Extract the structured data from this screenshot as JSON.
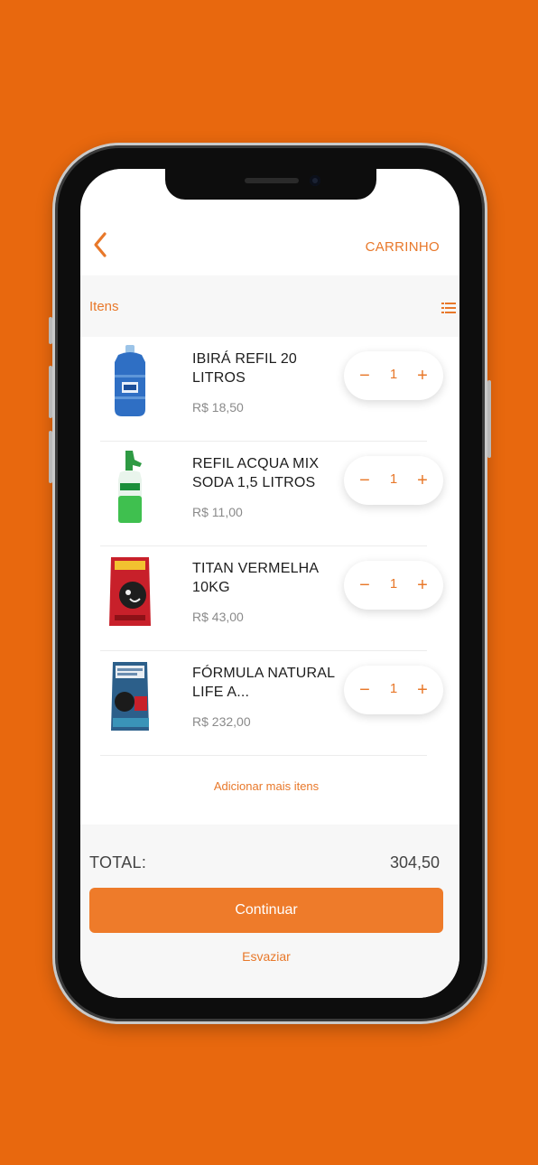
{
  "header": {
    "title": "CARRINHO"
  },
  "section": {
    "label": "Itens"
  },
  "items": [
    {
      "name": "IBIRÁ REFIL 20 LITROS",
      "price": "R$ 18,50",
      "qty": "1",
      "minus": "−",
      "plus": "+"
    },
    {
      "name": "REFIL ACQUA MIX SODA 1,5 LITROS",
      "price": "R$ 11,00",
      "qty": "1",
      "minus": "−",
      "plus": "+"
    },
    {
      "name": "TITAN VERMELHA 10KG",
      "price": "R$ 43,00",
      "qty": "1",
      "minus": "−",
      "plus": "+"
    },
    {
      "name": "FÓRMULA NATURAL LIFE A...",
      "price": "R$ 232,00",
      "qty": "1",
      "minus": "−",
      "plus": "+"
    }
  ],
  "add_more": "Adicionar mais itens",
  "footer": {
    "total_label": "TOTAL:",
    "total_value": "304,50",
    "continue_label": "Continuar",
    "empty_label": "Esvaziar"
  },
  "colors": {
    "accent": "#E8782A",
    "background": "#E8680E",
    "button": "#EE7B2A"
  },
  "icons": {
    "back": "chevron-left-icon",
    "list": "list-icon"
  }
}
